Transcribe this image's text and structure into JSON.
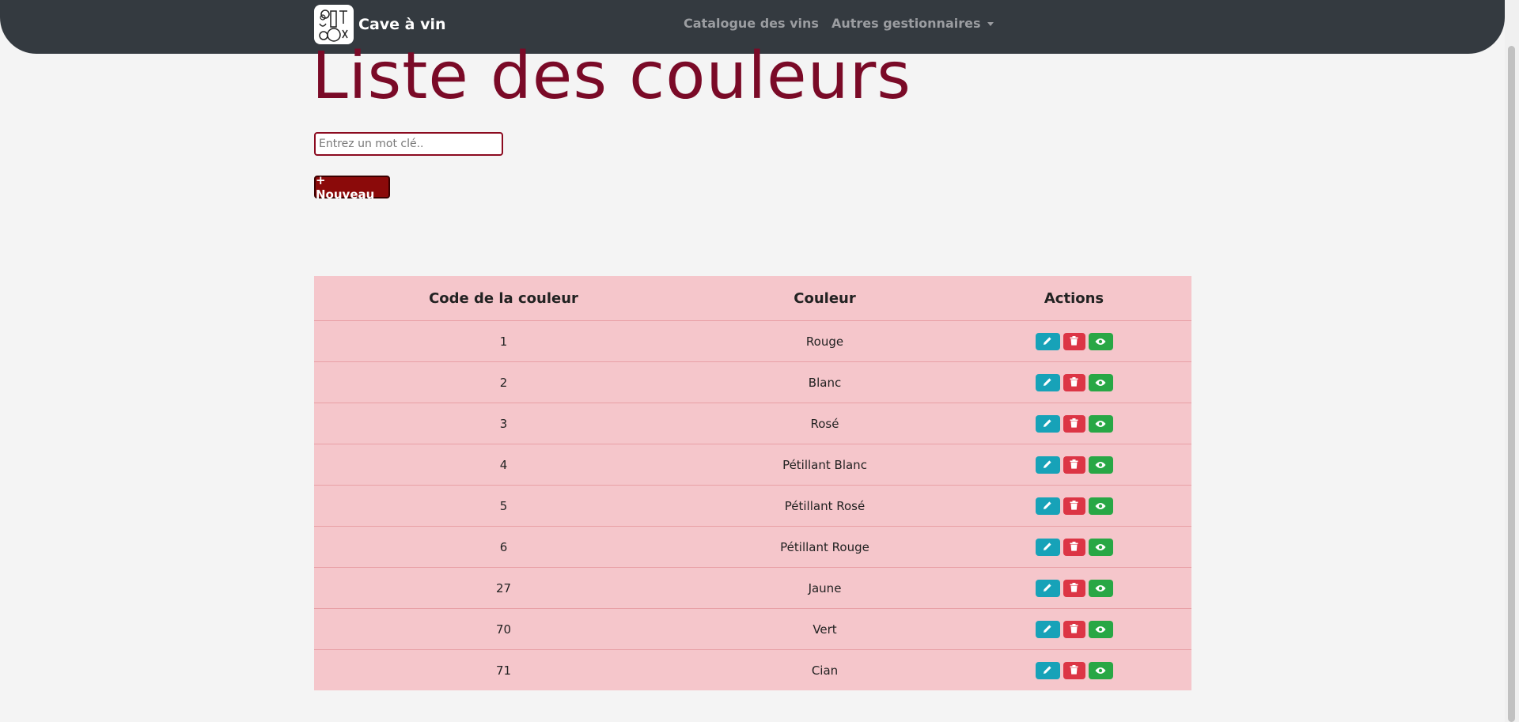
{
  "navbar": {
    "brand": "Cave à vin",
    "links": [
      {
        "label": "Catalogue des vins"
      },
      {
        "label": "Autres gestionnaires"
      }
    ]
  },
  "page": {
    "title": "Liste des couleurs",
    "search_placeholder": "Entrez un mot clé..",
    "new_button": "+ Nouveau"
  },
  "table": {
    "headers": [
      "Code de la couleur",
      "Couleur",
      "Actions"
    ],
    "rows": [
      {
        "code": "1",
        "color": "Rouge"
      },
      {
        "code": "2",
        "color": "Blanc"
      },
      {
        "code": "3",
        "color": "Rosé"
      },
      {
        "code": "4",
        "color": "Pétillant Blanc"
      },
      {
        "code": "5",
        "color": "Pétillant Rosé"
      },
      {
        "code": "6",
        "color": "Pétillant Rouge"
      },
      {
        "code": "27",
        "color": "Jaune"
      },
      {
        "code": "70",
        "color": "Vert"
      },
      {
        "code": "71",
        "color": "Cian"
      }
    ],
    "action_icons": [
      "pencil-icon",
      "trash-icon",
      "eye-icon"
    ]
  },
  "colors": {
    "navbar": "#343a40",
    "title": "#7a0a27",
    "table_bg": "#f5c6cb",
    "edit": "#17a2b8",
    "delete": "#dc3545",
    "view": "#28a745",
    "new_button": "#8b0a0a"
  }
}
